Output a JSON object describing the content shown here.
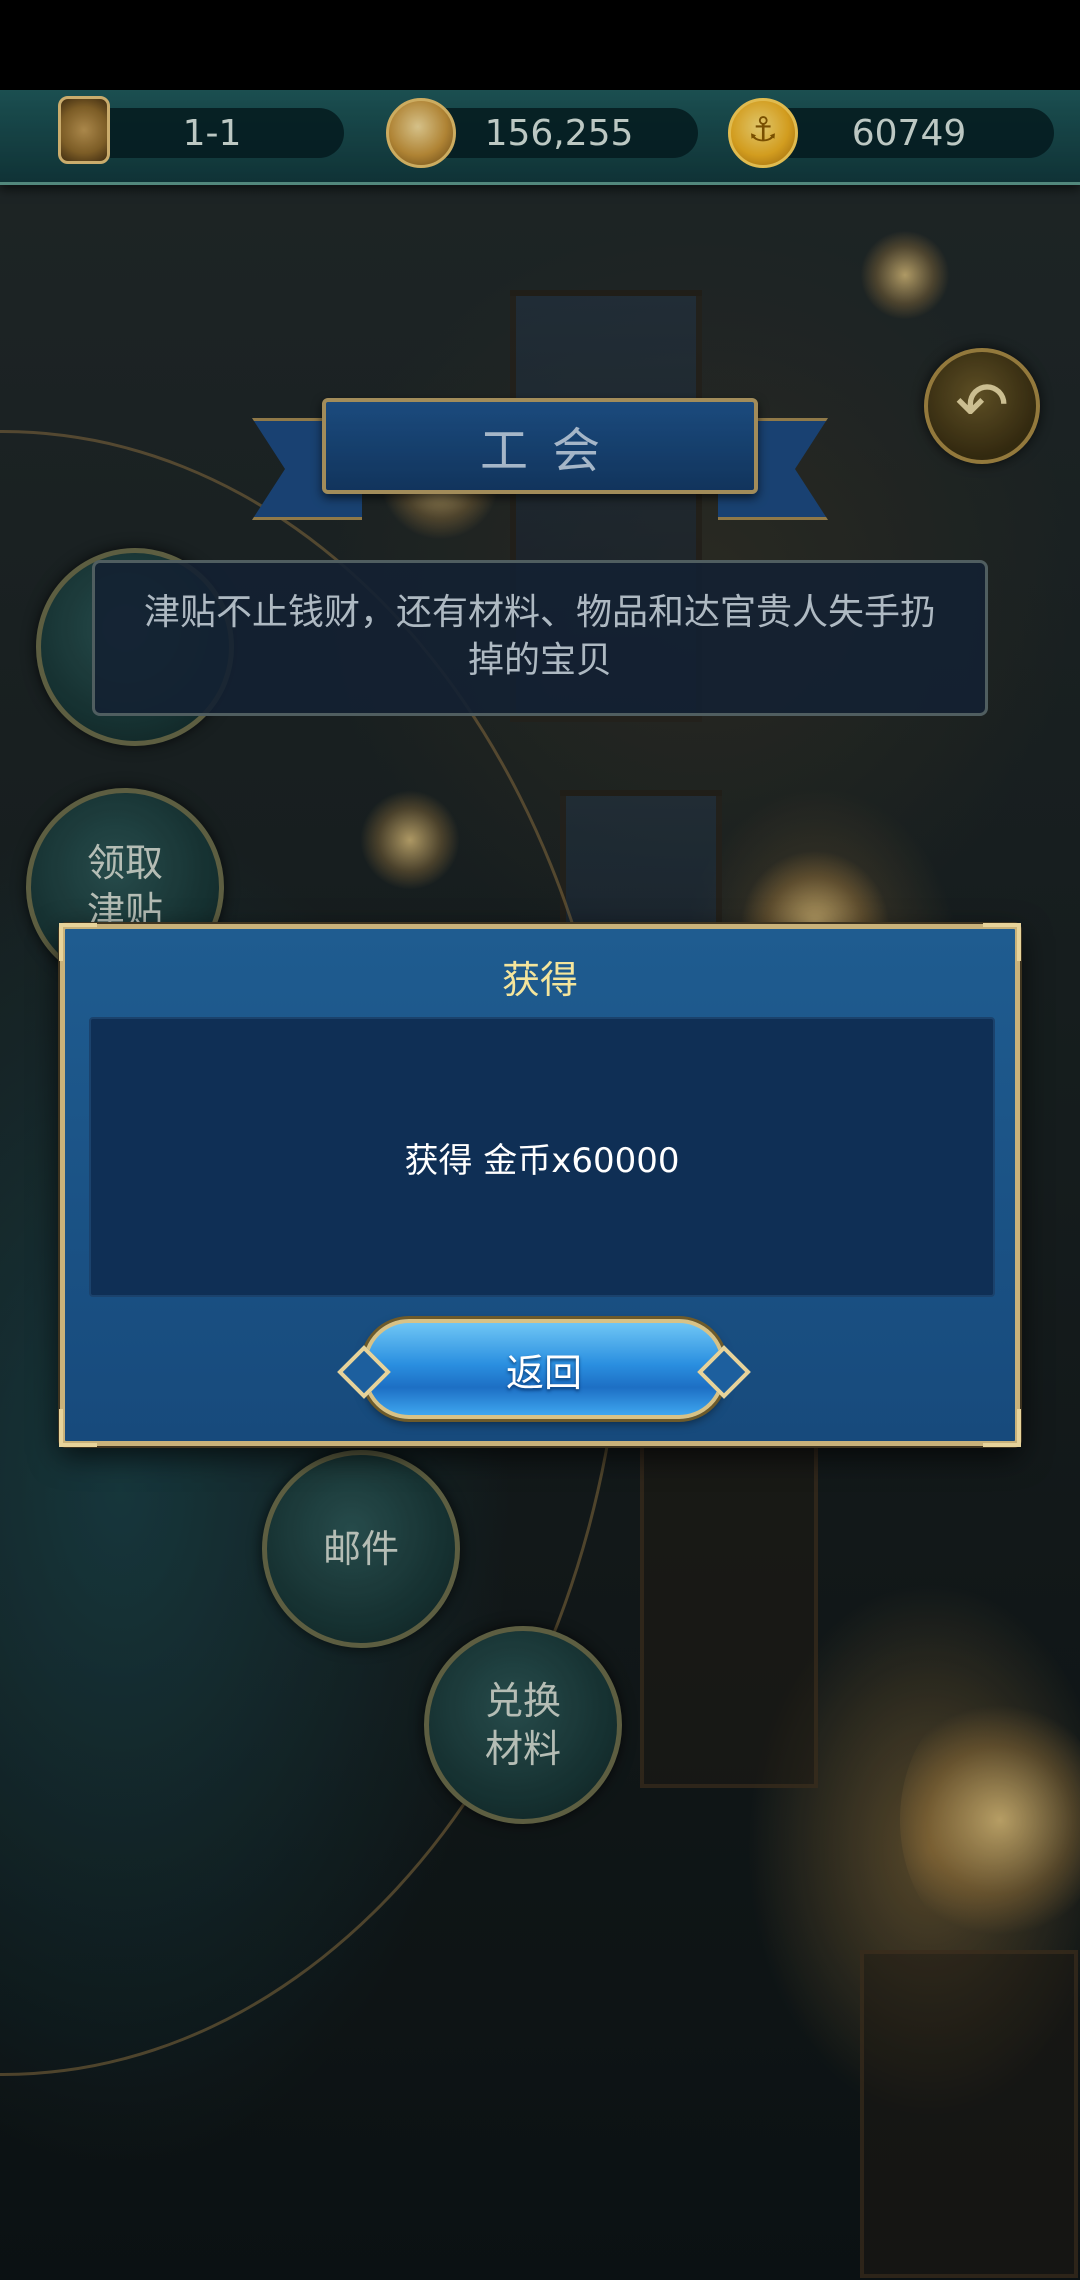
{
  "resources": {
    "stage": "1-1",
    "compass_value": "156,255",
    "gold_value": "60749",
    "gold_coin_glyph": "⚓"
  },
  "icons": {
    "back": "↶"
  },
  "banner": {
    "title": "工会"
  },
  "description": "津贴不止钱财，还有材料、物品和达官贵人失手扔掉的宝贝",
  "side_buttons": {
    "claim_allowance": "领取津贴",
    "mail": "邮件",
    "exchange_materials": "兑换材料"
  },
  "dialog": {
    "title": "获得",
    "message": "获得 金币x60000",
    "return_label": "返回"
  },
  "colors": {
    "dialog_title": "#f4e59c",
    "dialog_bg": "#1f5c90",
    "frame_gold": "#c9b27a",
    "resource_bar": "#1f5a5c"
  }
}
